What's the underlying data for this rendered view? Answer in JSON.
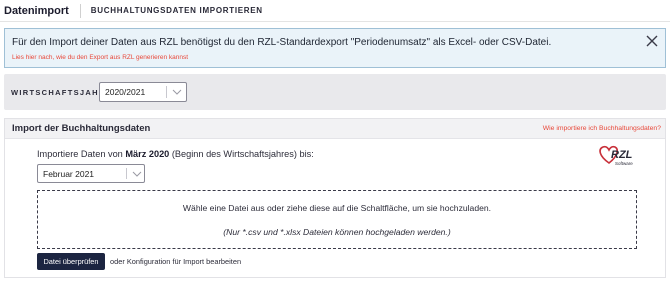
{
  "header": {
    "title": "Datenimport",
    "breadcrumb": "BUCHHALTUNGSDATEN IMPORTIEREN"
  },
  "info_banner": {
    "text": "Für den Import deiner Daten aus RZL benötigst du den RZL-Standardexport \"Periodenumsatz\" als Excel- oder CSV-Datei.",
    "link": "Lies hier nach, wie du den Export aus RZL generieren kannst",
    "close_icon": "close-icon"
  },
  "fiscal_year": {
    "label": "WIRTSCHAFTSJAHR",
    "selected": "2020/2021"
  },
  "import_panel": {
    "title": "Import der Buchhaltungsdaten",
    "help_link": "Wie importiere ich Buchhaltungsdaten?",
    "intro_prefix": "Importiere Daten von ",
    "intro_bold": "März 2020",
    "intro_suffix": " (Beginn des Wirtschaftsjahres) bis:",
    "end_month": "Februar 2021",
    "logo_name": "rzl-software-logo",
    "dropzone": {
      "text": "Wähle eine Datei aus oder ziehe diese auf die Schaltfläche, um sie hochzuladen.",
      "hint": "(Nur *.csv und *.xlsx Dateien können hochgeladen werden.)"
    },
    "check_button": "Datei überprüfen",
    "alt_link": "oder Konfiguration für Import bearbeiten"
  },
  "colors": {
    "accent_link": "#e8483a",
    "primary_button": "#1c2541",
    "info_bg": "#eaf3f9",
    "info_border": "#9fc0d6"
  }
}
